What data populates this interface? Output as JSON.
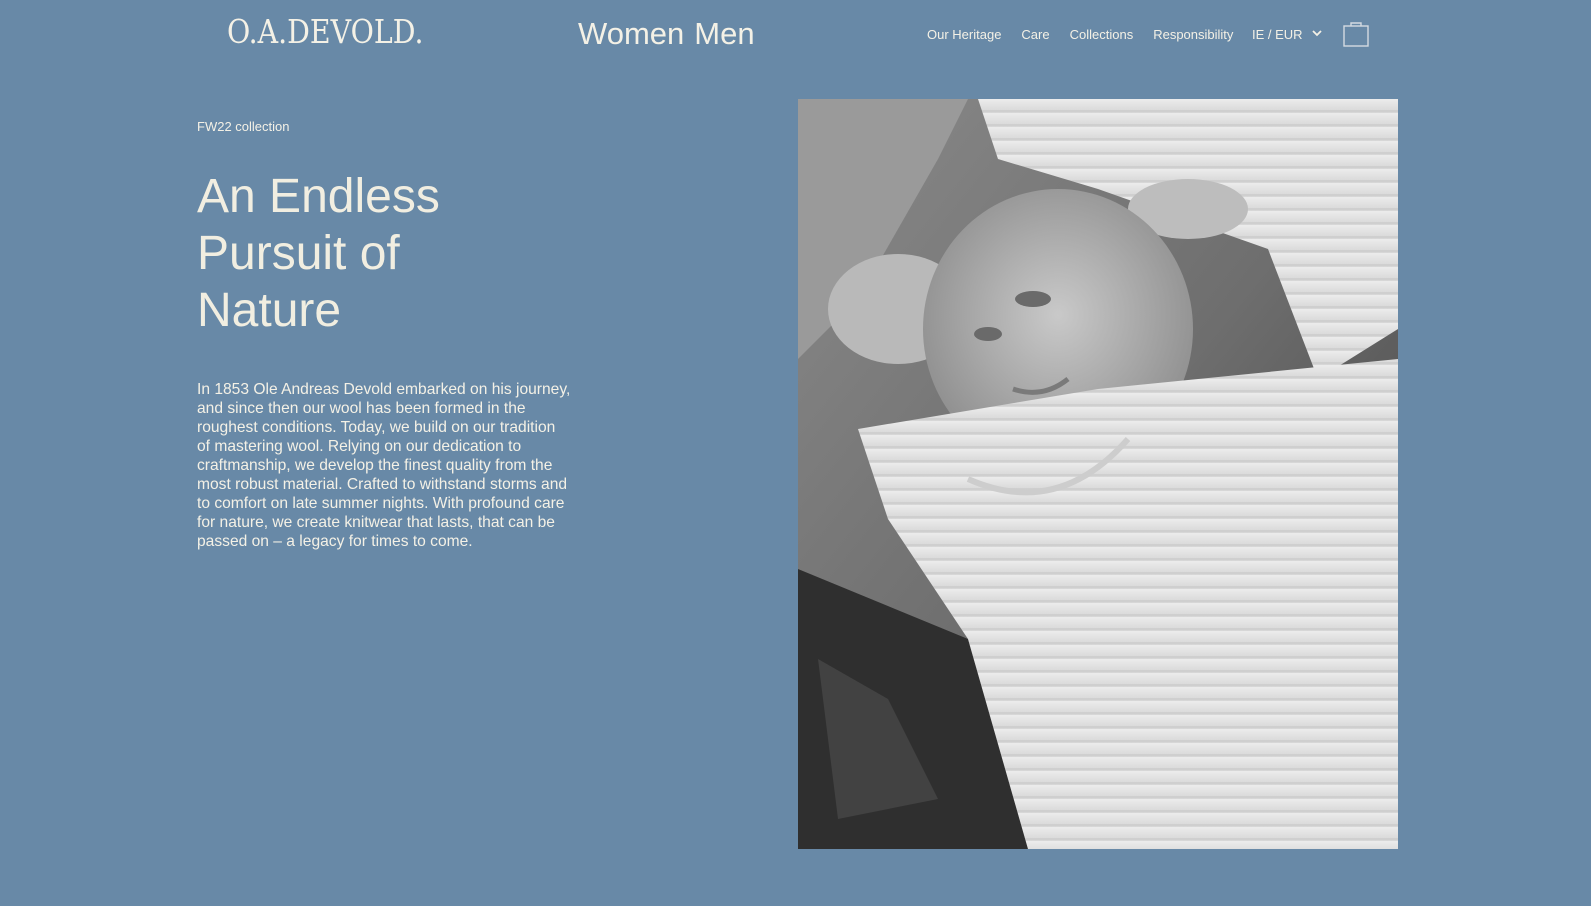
{
  "brand": {
    "logo_text": "O.A.DEVOLD."
  },
  "gender_nav": {
    "women": "Women",
    "men": "Men"
  },
  "main_nav": {
    "items": [
      {
        "label": "Our Heritage"
      },
      {
        "label": "Care"
      },
      {
        "label": "Collections"
      },
      {
        "label": "Responsibility"
      }
    ]
  },
  "locale": {
    "label": "IE / EUR",
    "icon": "chevron-down-icon"
  },
  "cart": {
    "icon": "shopping-bag-icon"
  },
  "hero": {
    "kicker": "FW22 collection",
    "title": "An Endless Pursuit of Nature",
    "body": "In 1853 Ole Andreas Devold embarked on his journey, and since then our wool has been formed in the roughest conditions. Today, we build on our tradition of mastering wool. Relying on our dedication to craftmanship, we develop the finest quality from the most robust material. Crafted to withstand storms and to comfort on late summer nights. With profound care for nature, we create knitwear that lasts, that can be passed on – a legacy for times to come."
  },
  "colors": {
    "background": "#6889a7",
    "text": "#f4f1e6"
  }
}
